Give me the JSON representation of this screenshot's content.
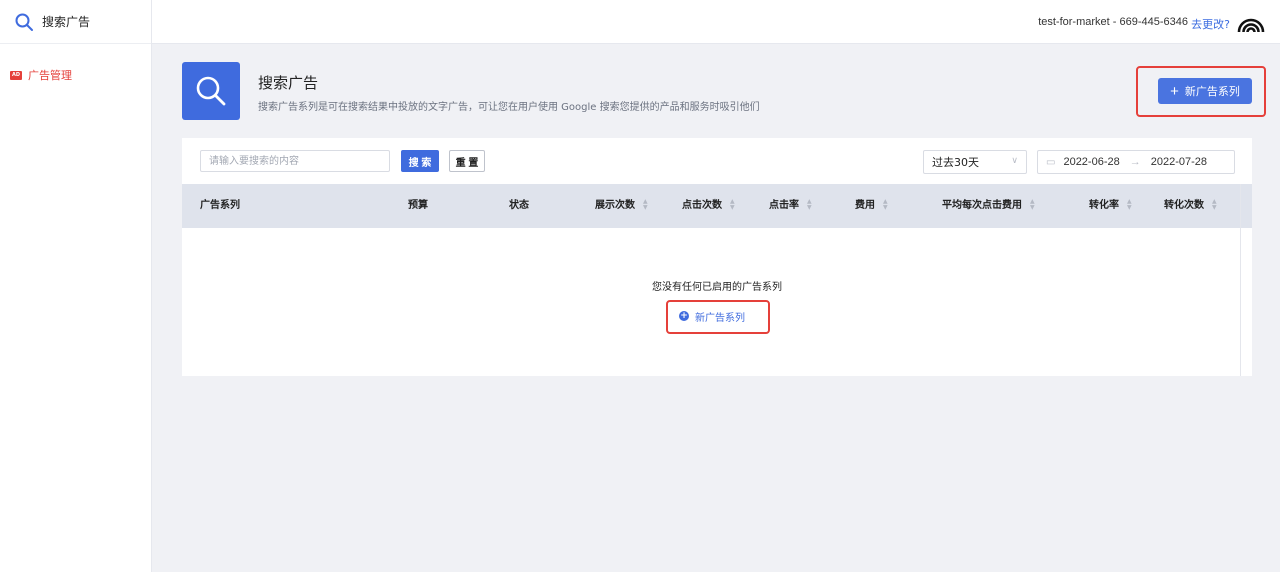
{
  "sidebar": {
    "title": "搜索广告",
    "items": [
      {
        "badge": "AD",
        "label": "广告管理"
      }
    ]
  },
  "topbar": {
    "account": "test-for-market - 669-445-6346",
    "change_link": "去更改?"
  },
  "hero": {
    "title": "搜索广告",
    "description": "搜索广告系列是可在搜索结果中投放的文字广告，可让您在用户使用 Google 搜索您提供的产品和服务时吸引他们",
    "new_button": "新广告系列"
  },
  "filters": {
    "search_placeholder": "请输入要搜索的内容",
    "search_button": "搜 索",
    "reset_button": "重 置",
    "range_select": "过去30天",
    "date_start": "2022-06-28",
    "date_end": "2022-07-28"
  },
  "table": {
    "columns": [
      "广告系列",
      "预算",
      "状态",
      "展示次数",
      "点击次数",
      "点击率",
      "费用",
      "平均每次点击费用",
      "转化率",
      "转化次数"
    ],
    "empty_text": "您没有任何已启用的广告系列",
    "empty_link": "新广告系列"
  },
  "colors": {
    "accent": "#3f6bde",
    "highlight_red": "#e5403a",
    "header_bg": "#dfe3ec"
  }
}
